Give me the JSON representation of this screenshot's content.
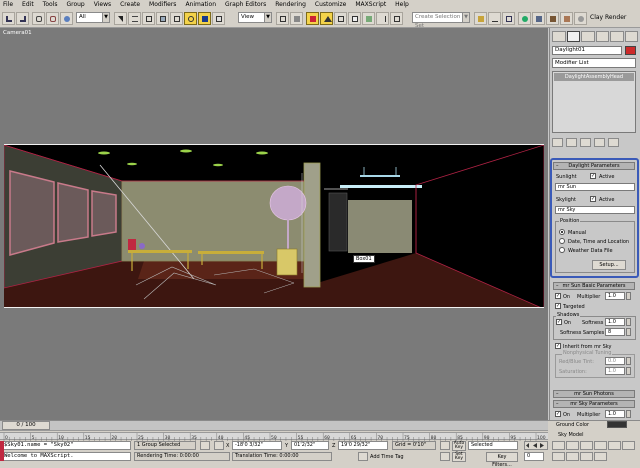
{
  "menu": [
    "File",
    "Edit",
    "Tools",
    "Group",
    "Views",
    "Create",
    "Modifiers",
    "Animation",
    "Graph Editors",
    "Rendering",
    "Customize",
    "MAXScript",
    "Help"
  ],
  "toolbar": {
    "selection_filter": "All",
    "coord_system": "View",
    "named_selection_placeholder": "Create Selection Set",
    "clay_render": "Clay Render"
  },
  "viewport": {
    "label": "Camera01",
    "box_label": "Box01"
  },
  "command_panel": {
    "object_name": "Daylight01",
    "modifier_list": "Modifier List",
    "stack_item": "DaylightAssemblyHead",
    "daylight": {
      "header": "Daylight Parameters",
      "sunlight_label": "Sunlight",
      "sunlight_active": "Active",
      "sun_type": "mr Sun",
      "skylight_label": "Skylight",
      "skylight_active": "Active",
      "sky_type": "mr Sky",
      "position_label": "Position",
      "position_options": [
        "Manual",
        "Date, Time and Location",
        "Weather Data File"
      ],
      "setup_button": "Setup..."
    },
    "sun_basic": {
      "header": "mr Sun Basic Parameters",
      "on_label": "On",
      "multiplier_label": "Multiplier",
      "multiplier_value": "1.0",
      "targeted_label": "Targeted",
      "shadows_label": "Shadows",
      "shadows_on": "On",
      "softness_label": "Softness",
      "softness_value": "1.0",
      "softness_samples_label": "Softness Samples",
      "softness_samples_value": "8",
      "inherit_label": "Inherit from mr Sky",
      "nonphysical_label": "Nonphysical Tuning",
      "redblue_label": "Red/Blue Tint:",
      "redblue_value": "0.0",
      "saturation_label": "Saturation:",
      "saturation_value": "1.0"
    },
    "sun_photons": "mr Sun Photons",
    "sky_params": {
      "header": "mr Sky Parameters",
      "on_label": "On",
      "multiplier_label": "Multiplier",
      "multiplier_value": "1.0",
      "ground_color_label": "Ground Color",
      "sky_model_label": "Sky Model"
    }
  },
  "timeline": {
    "frame": "0 / 100",
    "ticks": [
      "0",
      "5",
      "10",
      "15",
      "20",
      "25",
      "30",
      "35",
      "40",
      "45",
      "50",
      "55",
      "60",
      "65",
      "70",
      "75",
      "80",
      "85",
      "90",
      "95",
      "100"
    ]
  },
  "status": {
    "maxscript_line1": "$Sky01.name = \"Sky02\"",
    "maxscript_line2": "Welcome to MAXScript.",
    "selection_count": "1 Group Selected",
    "prompt": "Rendering Time: 0:00:00",
    "translation_time": "Translation Time: 0:00:00",
    "x_label": "X",
    "x_value": "-18'0 3/32\"",
    "y_label": "Y",
    "y_value": "01'2/32\"",
    "z_label": "Z",
    "z_value": "19'0 29/32\"",
    "grid": "Grid = 0'10\"",
    "auto_key": "Auto Key",
    "set_key": "Set Key",
    "key_filter_value": "Selected",
    "key_filters": "Key Filters...",
    "add_time_tag": "Add Time Tag",
    "frame_field": "0"
  }
}
